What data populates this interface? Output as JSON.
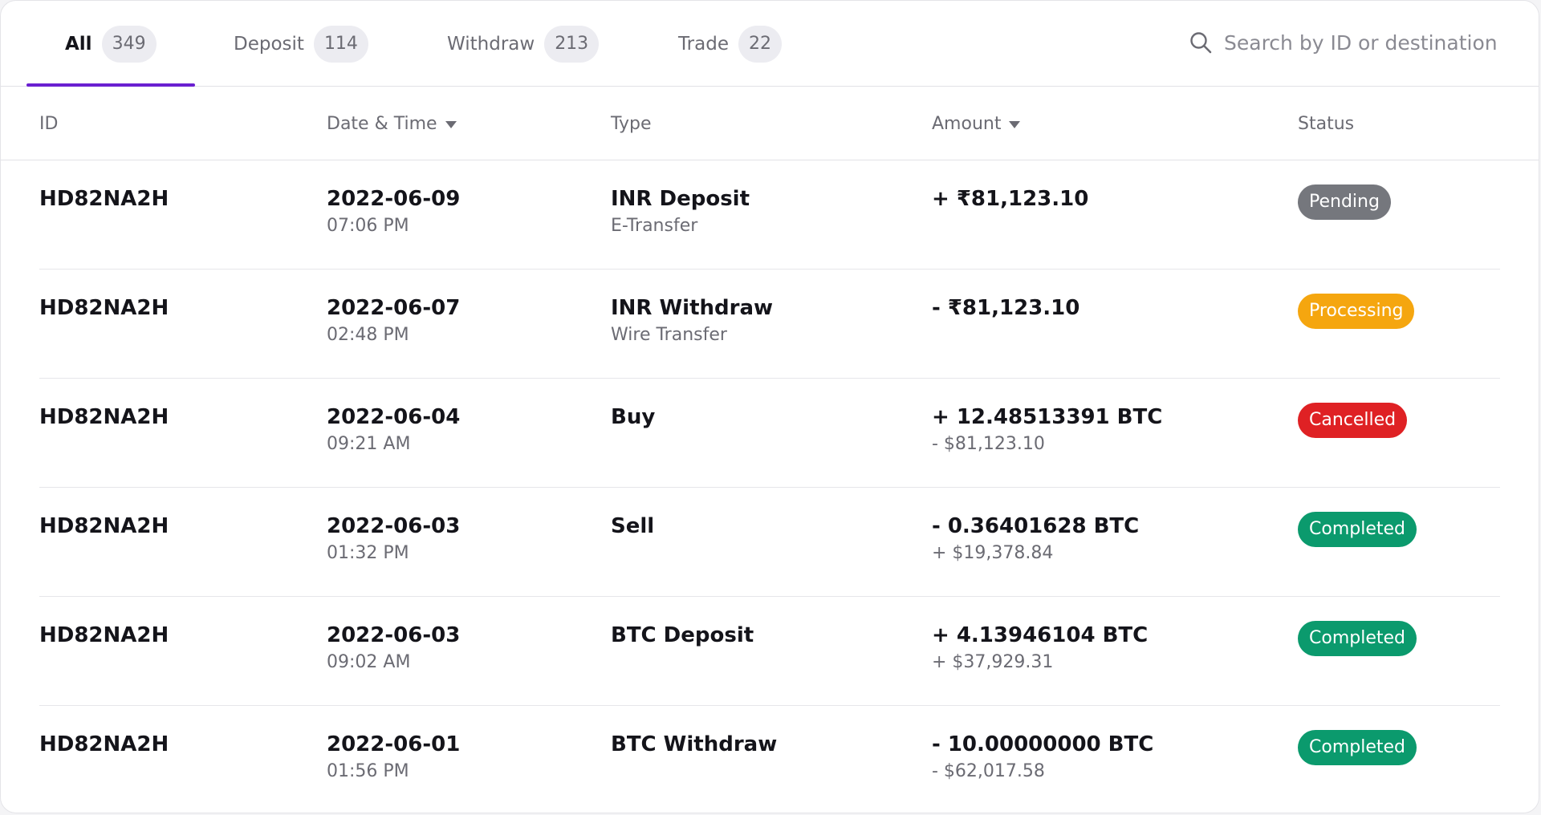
{
  "tabs": [
    {
      "label": "All",
      "count": "349",
      "active": true
    },
    {
      "label": "Deposit",
      "count": "114",
      "active": false
    },
    {
      "label": "Withdraw",
      "count": "213",
      "active": false
    },
    {
      "label": "Trade",
      "count": "22",
      "active": false
    }
  ],
  "search": {
    "placeholder": "Search by ID or destination",
    "value": ""
  },
  "table": {
    "columns": [
      {
        "label": "ID",
        "sortable": false
      },
      {
        "label": "Date & Time",
        "sortable": true
      },
      {
        "label": "Type",
        "sortable": false
      },
      {
        "label": "Amount",
        "sortable": true
      },
      {
        "label": "Status",
        "sortable": false
      }
    ],
    "rows": [
      {
        "id": "HD82NA2H",
        "date": "2022-06-09",
        "time": "07:06 PM",
        "type": "INR Deposit",
        "type_sub": "E-Transfer",
        "amount": "+ ₹81,123.10",
        "amount_sub": "",
        "status": "Pending",
        "status_kind": "pending"
      },
      {
        "id": "HD82NA2H",
        "date": "2022-06-07",
        "time": "02:48 PM",
        "type": "INR Withdraw",
        "type_sub": "Wire Transfer",
        "amount": "- ₹81,123.10",
        "amount_sub": "",
        "status": "Processing",
        "status_kind": "processing"
      },
      {
        "id": "HD82NA2H",
        "date": "2022-06-04",
        "time": "09:21 AM",
        "type": "Buy",
        "type_sub": "",
        "amount": "+ 12.48513391 BTC",
        "amount_sub": "- $81,123.10",
        "status": "Cancelled",
        "status_kind": "cancelled"
      },
      {
        "id": "HD82NA2H",
        "date": "2022-06-03",
        "time": "01:32 PM",
        "type": "Sell",
        "type_sub": "",
        "amount": "- 0.36401628 BTC",
        "amount_sub": "+ $19,378.84",
        "status": "Completed",
        "status_kind": "completed"
      },
      {
        "id": "HD82NA2H",
        "date": "2022-06-03",
        "time": "09:02 AM",
        "type": "BTC Deposit",
        "type_sub": "",
        "amount": "+ 4.13946104 BTC",
        "amount_sub": "+ $37,929.31",
        "status": "Completed",
        "status_kind": "completed"
      },
      {
        "id": "HD82NA2H",
        "date": "2022-06-01",
        "time": "01:56 PM",
        "type": "BTC Withdraw",
        "type_sub": "",
        "amount": "- 10.00000000 BTC",
        "amount_sub": "- $62,017.58",
        "status": "Completed",
        "status_kind": "completed"
      }
    ]
  },
  "colors": {
    "accent": "#6a1fd0",
    "pending": "#75777d",
    "processing": "#f5a60f",
    "cancelled": "#df2124",
    "completed": "#0b9a6d"
  },
  "icons": {
    "search": "search-icon",
    "sort": "caret-down-icon"
  }
}
